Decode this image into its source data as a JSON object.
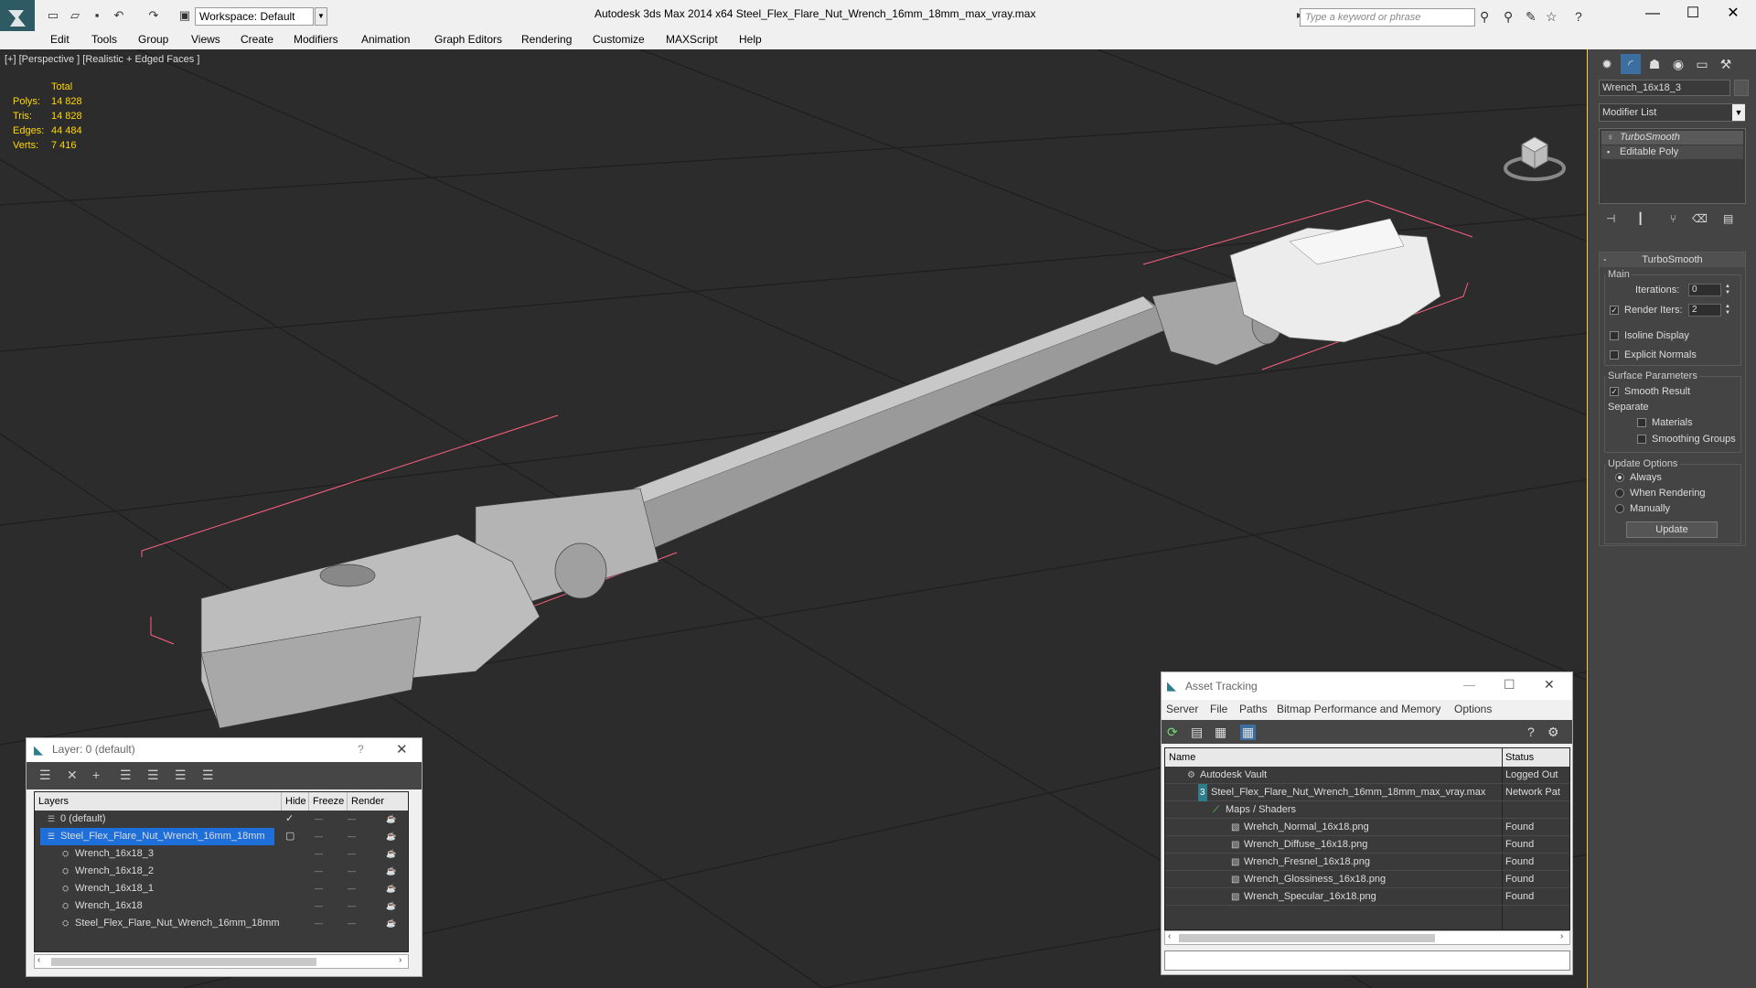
{
  "titlebar": {
    "workspace": "Workspace: Default",
    "title": "Autodesk 3ds Max  2014 x64     Steel_Flex_Flare_Nut_Wrench_16mm_18mm_max_vray.max",
    "search_placeholder": "Type a keyword or phrase"
  },
  "menu": [
    "Edit",
    "Tools",
    "Group",
    "Views",
    "Create",
    "Modifiers",
    "Animation",
    "Graph Editors",
    "Rendering",
    "Customize",
    "MAXScript",
    "Help"
  ],
  "viewport": {
    "label": "[+] [Perspective ] [Realistic + Edged Faces ]",
    "stats": {
      "header": "Total",
      "rows": [
        {
          "label": "Polys:",
          "value": "14 828"
        },
        {
          "label": "Tris:",
          "value": "14 828"
        },
        {
          "label": "Edges:",
          "value": "44 484"
        },
        {
          "label": "Verts:",
          "value": "7 416"
        }
      ]
    }
  },
  "command_panel": {
    "object_name": "Wrench_16x18_3",
    "modifier_list": "Modifier List",
    "stack": [
      "TurboSmooth",
      "Editable Poly"
    ],
    "rollout_title": "TurboSmooth",
    "main_label": "Main",
    "iterations_label": "Iterations:",
    "iterations_value": "0",
    "render_iters_label": "Render Iters:",
    "render_iters_value": "2",
    "isoline": "Isoline Display",
    "explicit_normals": "Explicit Normals",
    "surface_params": "Surface Parameters",
    "smooth_result": "Smooth Result",
    "separate": "Separate",
    "materials": "Materials",
    "smoothing_groups": "Smoothing Groups",
    "update_options": "Update Options",
    "always": "Always",
    "when_rendering": "When Rendering",
    "manually": "Manually",
    "update_button": "Update"
  },
  "layer_dialog": {
    "title": "Layer: 0 (default)",
    "help": "?",
    "columns": [
      "Layers",
      "Hide",
      "Freeze",
      "Render"
    ],
    "rows": [
      {
        "name": "0 (default)",
        "level": 0
      },
      {
        "name": "Steel_Flex_Flare_Nut_Wrench_16mm_18mm",
        "level": 0
      },
      {
        "name": "Wrench_16x18_3",
        "level": 1
      },
      {
        "name": "Wrench_16x18_2",
        "level": 1
      },
      {
        "name": "Wrench_16x18_1",
        "level": 1
      },
      {
        "name": "Wrench_16x18",
        "level": 1
      },
      {
        "name": "Steel_Flex_Flare_Nut_Wrench_16mm_18mm",
        "level": 1
      }
    ]
  },
  "asset_dialog": {
    "title": "Asset Tracking",
    "menu": [
      "Server",
      "File",
      "Paths",
      "Bitmap Performance and Memory",
      "Options"
    ],
    "columns": [
      "Name",
      "Status"
    ],
    "rows": [
      {
        "name": "Autodesk Vault",
        "status": "Logged Out"
      },
      {
        "name": "Steel_Flex_Flare_Nut_Wrench_16mm_18mm_max_vray.max",
        "status": "Network Pat"
      },
      {
        "name": "Maps / Shaders",
        "status": ""
      },
      {
        "name": "Wrehch_Normal_16x18.png",
        "status": "Found"
      },
      {
        "name": "Wrench_Diffuse_16x18.png",
        "status": "Found"
      },
      {
        "name": "Wrench_Fresnel_16x18.png",
        "status": "Found"
      },
      {
        "name": "Wrench_Glossiness_16x18.png",
        "status": "Found"
      },
      {
        "name": "Wrench_Specular_16x18.png",
        "status": "Found"
      }
    ]
  },
  "colors": {
    "viewport_bg": "#2c2c2c",
    "stats": "#ffd700",
    "selection": "#1e6fd9",
    "panel": "#444444"
  }
}
